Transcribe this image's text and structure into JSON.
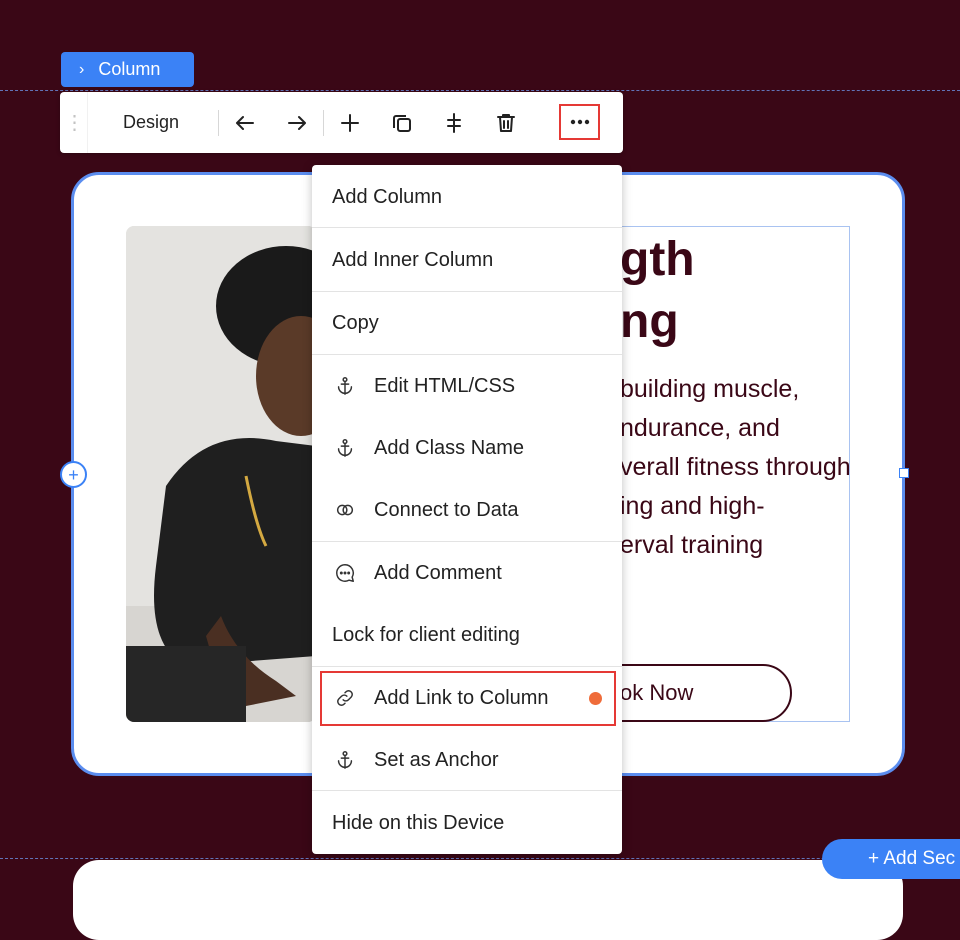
{
  "breadcrumb": {
    "label": "Column"
  },
  "toolbar": {
    "design_label": "Design"
  },
  "section": {
    "heading_line1": "gth",
    "heading_line2": "ng",
    "body_lines": [
      "building muscle,",
      "ndurance, and",
      "verall fitness through",
      "ing and high-",
      "erval training"
    ],
    "cta_label": "ok Now"
  },
  "menu": {
    "add_column": "Add Column",
    "add_inner_column": "Add Inner Column",
    "copy": "Copy",
    "edit_html_css": "Edit HTML/CSS",
    "add_class_name": "Add Class Name",
    "connect_to_data": "Connect to Data",
    "add_comment": "Add Comment",
    "lock_client_editing": "Lock for client editing",
    "add_link_to_column": "Add Link to Column",
    "set_as_anchor": "Set as Anchor",
    "hide_on_device": "Hide on this Device"
  },
  "add_section": {
    "label": "+ Add Sec"
  },
  "colors": {
    "background": "#3a0716",
    "accent": "#3b82f6",
    "highlight": "#e53935",
    "notification": "#ef6c3a"
  },
  "icons": [
    "chevron-right-icon",
    "drag-handle-icon",
    "arrow-left-icon",
    "arrow-right-icon",
    "plus-icon",
    "duplicate-icon",
    "align-icon",
    "trash-icon",
    "more-icon",
    "anchor-icon",
    "connect-data-icon",
    "comment-icon",
    "link-icon"
  ]
}
